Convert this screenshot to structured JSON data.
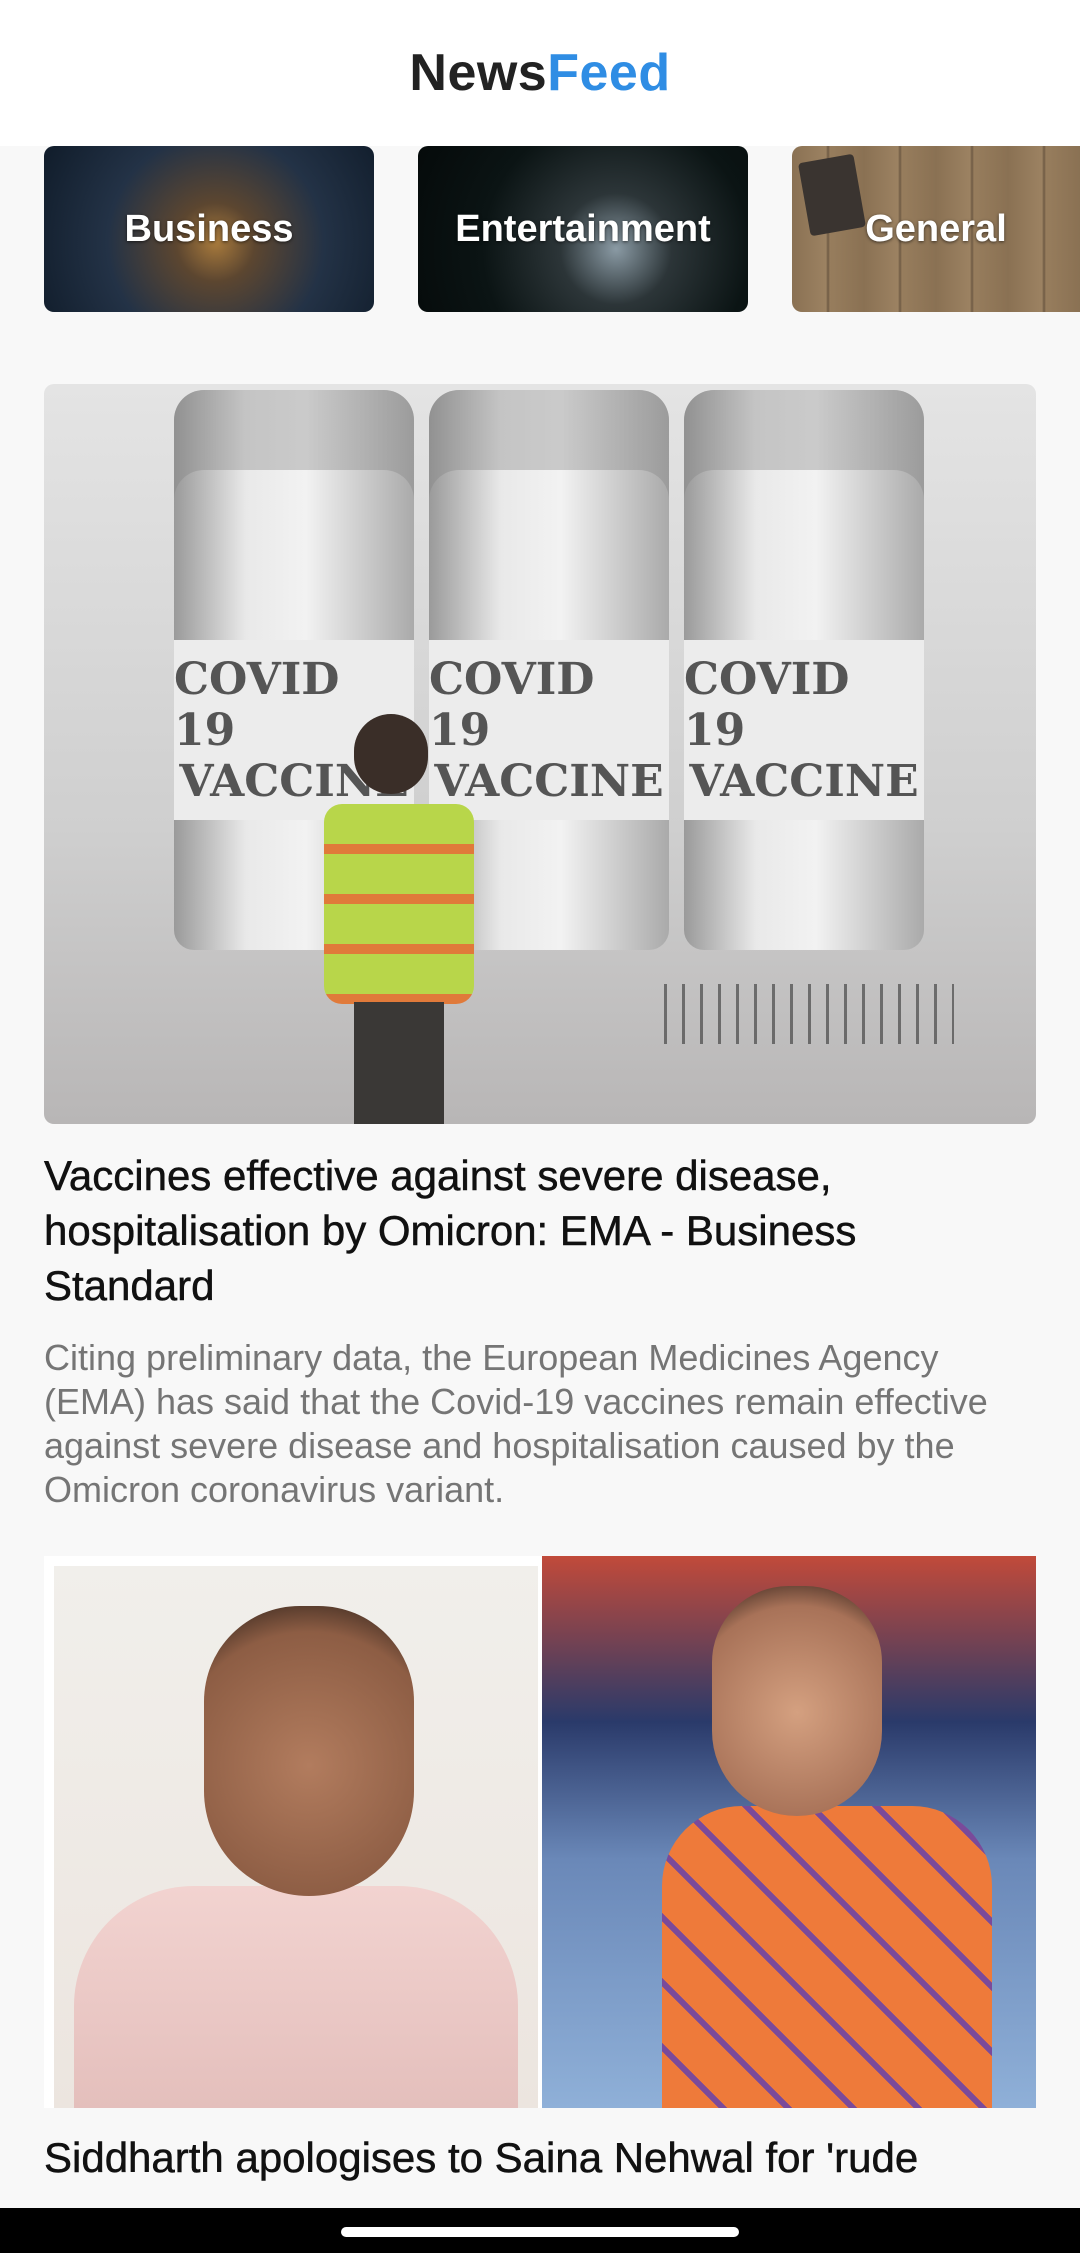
{
  "app": {
    "title_part1": "News",
    "title_part2": "Feed",
    "title_colors": {
      "news": "#222222",
      "feed": "#2f8de4"
    }
  },
  "categories": [
    {
      "label": "Business"
    },
    {
      "label": "Entertainment"
    },
    {
      "label": "General"
    }
  ],
  "articles": [
    {
      "image_text": {
        "line1": "COVID 19",
        "line2": "VACCINE"
      },
      "title": "Vaccines effective against severe disease, hospitalisation by Omicron: EMA - Business Standard",
      "description": "Citing preliminary data, the European Medicines Agency (EMA) has said that the Covid-19 vaccines remain effective against severe disease and hospitalisation caused by the Omicron coronavirus variant."
    },
    {
      "title": "Siddharth apologises to Saina Nehwal for 'rude"
    }
  ],
  "system": {
    "home_indicator": "home-indicator"
  }
}
